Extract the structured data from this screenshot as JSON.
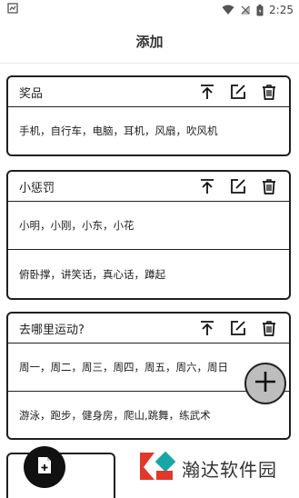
{
  "status_bar": {
    "time": "2:25"
  },
  "app_bar": {
    "title": "添加"
  },
  "cards": [
    {
      "title": "奖品",
      "rows": [
        "手机，自行车，电脑，耳机，风扇，吹风机"
      ]
    },
    {
      "title": "小惩罚",
      "rows": [
        "小明，小刚，小东，小花",
        "俯卧撑，讲笑话，真心话，蹲起"
      ]
    },
    {
      "title": "去哪里运动?",
      "rows": [
        "周一，周二，周三，周四，周五，周六，周日",
        "游泳，跑步，健身房，爬山,跳舞，练武术"
      ]
    }
  ],
  "watermark": {
    "text": "瀚达软件园"
  },
  "icons": {
    "pin_top": "pin-top-icon",
    "edit": "edit-icon",
    "delete": "trash-icon",
    "add": "plus-icon",
    "document": "document-icon"
  }
}
